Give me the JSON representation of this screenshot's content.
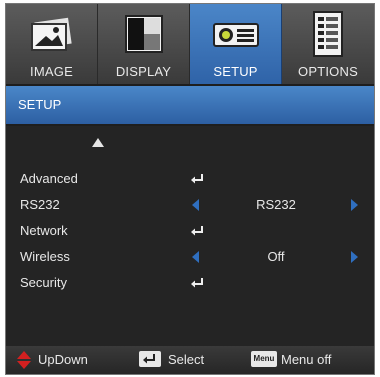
{
  "tabs": [
    {
      "label": "IMAGE",
      "icon": "image-icon"
    },
    {
      "label": "DISPLAY",
      "icon": "display-icon"
    },
    {
      "label": "SETUP",
      "icon": "projector-icon",
      "active": true
    },
    {
      "label": "OPTIONS",
      "icon": "options-list-icon"
    }
  ],
  "title": "SETUP",
  "menu": [
    {
      "label": "Advanced"
    },
    {
      "label": "RS232",
      "value": "RS232"
    },
    {
      "label": "Network"
    },
    {
      "label": "Wireless",
      "value": "Off"
    },
    {
      "label": "Security"
    }
  ],
  "footer": {
    "updown": "UpDown",
    "select": "Select",
    "menu_key": "Menu",
    "menu_off": "Menu off"
  },
  "colors": {
    "accent": "#2f63a8",
    "arrow_blue": "#2f6fc0",
    "updown_red": "#d42020"
  }
}
